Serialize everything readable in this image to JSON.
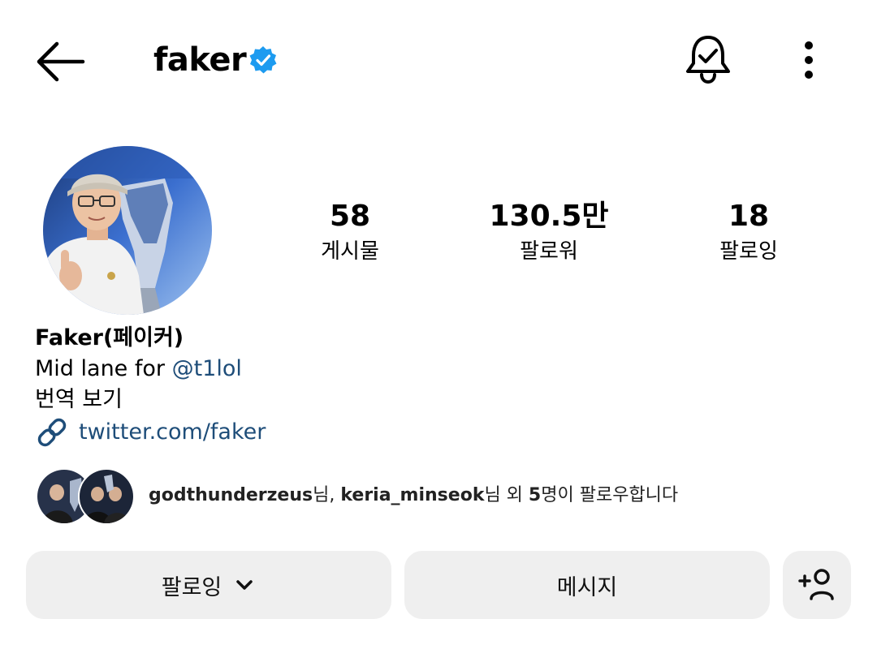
{
  "header": {
    "username": "faker",
    "icons": {
      "back": "back-arrow-icon",
      "verified": "verified-badge-icon",
      "notifications": "bell-check-icon",
      "more": "more-vertical-icon"
    },
    "verified_color": "#1d9bf0"
  },
  "profile": {
    "stats": [
      {
        "value": "58",
        "label": "게시물"
      },
      {
        "value": "130.5만",
        "label": "팔로워"
      },
      {
        "value": "18",
        "label": "팔로잉"
      }
    ],
    "display_name": "Faker(페이커)",
    "bio_prefix": "Mid lane for ",
    "bio_mention": "@t1lol",
    "translate_label": "번역 보기",
    "link_text": "twitter.com/faker",
    "link_color": "#1e4d79"
  },
  "followed_by": {
    "user1": "godthunderzeus",
    "suffix1": "님, ",
    "user2": "keria_minseok",
    "suffix2": "님 외 ",
    "count": "5",
    "suffix3": "명이 팔로우합니다"
  },
  "actions": {
    "following_label": "팔로잉",
    "message_label": "메시지",
    "add_user_icon": "add-user-icon"
  }
}
